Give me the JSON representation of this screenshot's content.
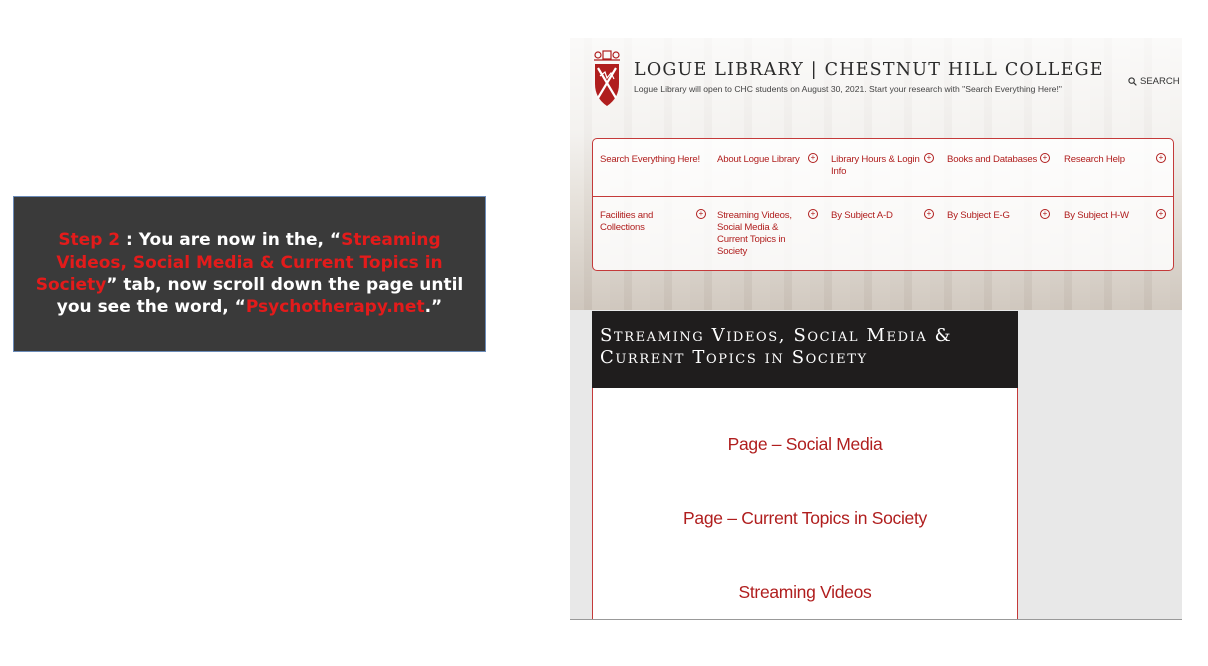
{
  "instruction": {
    "step_label": "Step 2",
    "sep": " : You are now in the, “",
    "tab_name": "Streaming Videos, Social Media & Current Topics in Society",
    "mid": "” tab, now scroll down the page until you see the  word, “",
    "target_word": "Psychotherapy.net",
    "end": ".”",
    "colors": {
      "highlight": "#e31b1b",
      "background": "#3a3a3a",
      "text": "#ffffff"
    }
  },
  "site": {
    "title": "LOGUE LIBRARY | CHESTNUT HILL COLLEGE",
    "subtitle": "Logue Library will open to CHC students on August 30, 2021. Start your research with \"Search Everything Here!\"",
    "search_label": "SEARCH",
    "accent": "#b01e1e"
  },
  "nav": {
    "row1": [
      {
        "label": "Search Everything Here!",
        "expandable": false
      },
      {
        "label": "About Logue Library",
        "expandable": true
      },
      {
        "label": "Library Hours & Login Info",
        "expandable": true
      },
      {
        "label": "Books and Databases",
        "expandable": true
      },
      {
        "label": "Research Help",
        "expandable": true
      }
    ],
    "row2": [
      {
        "label": "Facilities and Collections",
        "expandable": true
      },
      {
        "label": "Streaming Videos, Social Media & Current Topics in Society",
        "expandable": true
      },
      {
        "label": "By Subject A-D",
        "expandable": true
      },
      {
        "label": "By Subject E-G",
        "expandable": true
      },
      {
        "label": "By Subject H-W",
        "expandable": true
      }
    ],
    "expand_icon": "circle-plus-icon"
  },
  "section": {
    "heading": "Streaming Videos, Social Media & Current Topics in Society",
    "links": [
      "Page – Social Media",
      "Page – Current Topics in Society",
      "Streaming Videos"
    ]
  }
}
